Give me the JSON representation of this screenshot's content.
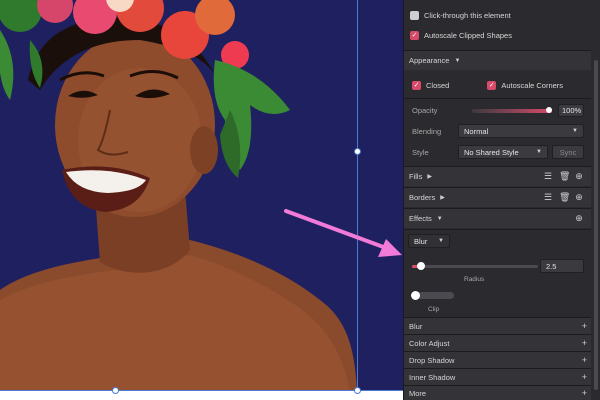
{
  "panel": {
    "click_through_label": "Click-through this element",
    "autoscale_clipped_label": "Autoscale Clipped Shapes",
    "appearance": {
      "title": "Appearance",
      "closed_label": "Closed",
      "autoscale_corners_label": "Autoscale Corners",
      "opacity_label": "Opacity",
      "opacity_value": "100%",
      "opacity_level": 1.0,
      "blending_label": "Blending",
      "blending_value": "Normal",
      "style_label": "Style",
      "style_value": "No Shared Style",
      "sync_label": "Sync"
    },
    "fills_label": "Fills",
    "borders_label": "Borders",
    "effects_label": "Effects",
    "blur": {
      "type_label": "Blur",
      "radius_value": "2.5",
      "radius_label": "Radius",
      "clip_label": "Clip"
    },
    "effect_list": [
      "Blur",
      "Color Adjust",
      "Drop Shadow",
      "Inner Shadow",
      "More"
    ]
  },
  "colors": {
    "canvas_bg": "#1f2060",
    "accent": "#d84a6a",
    "arrow": "#f27ad8",
    "guide": "#4d7ad0"
  }
}
